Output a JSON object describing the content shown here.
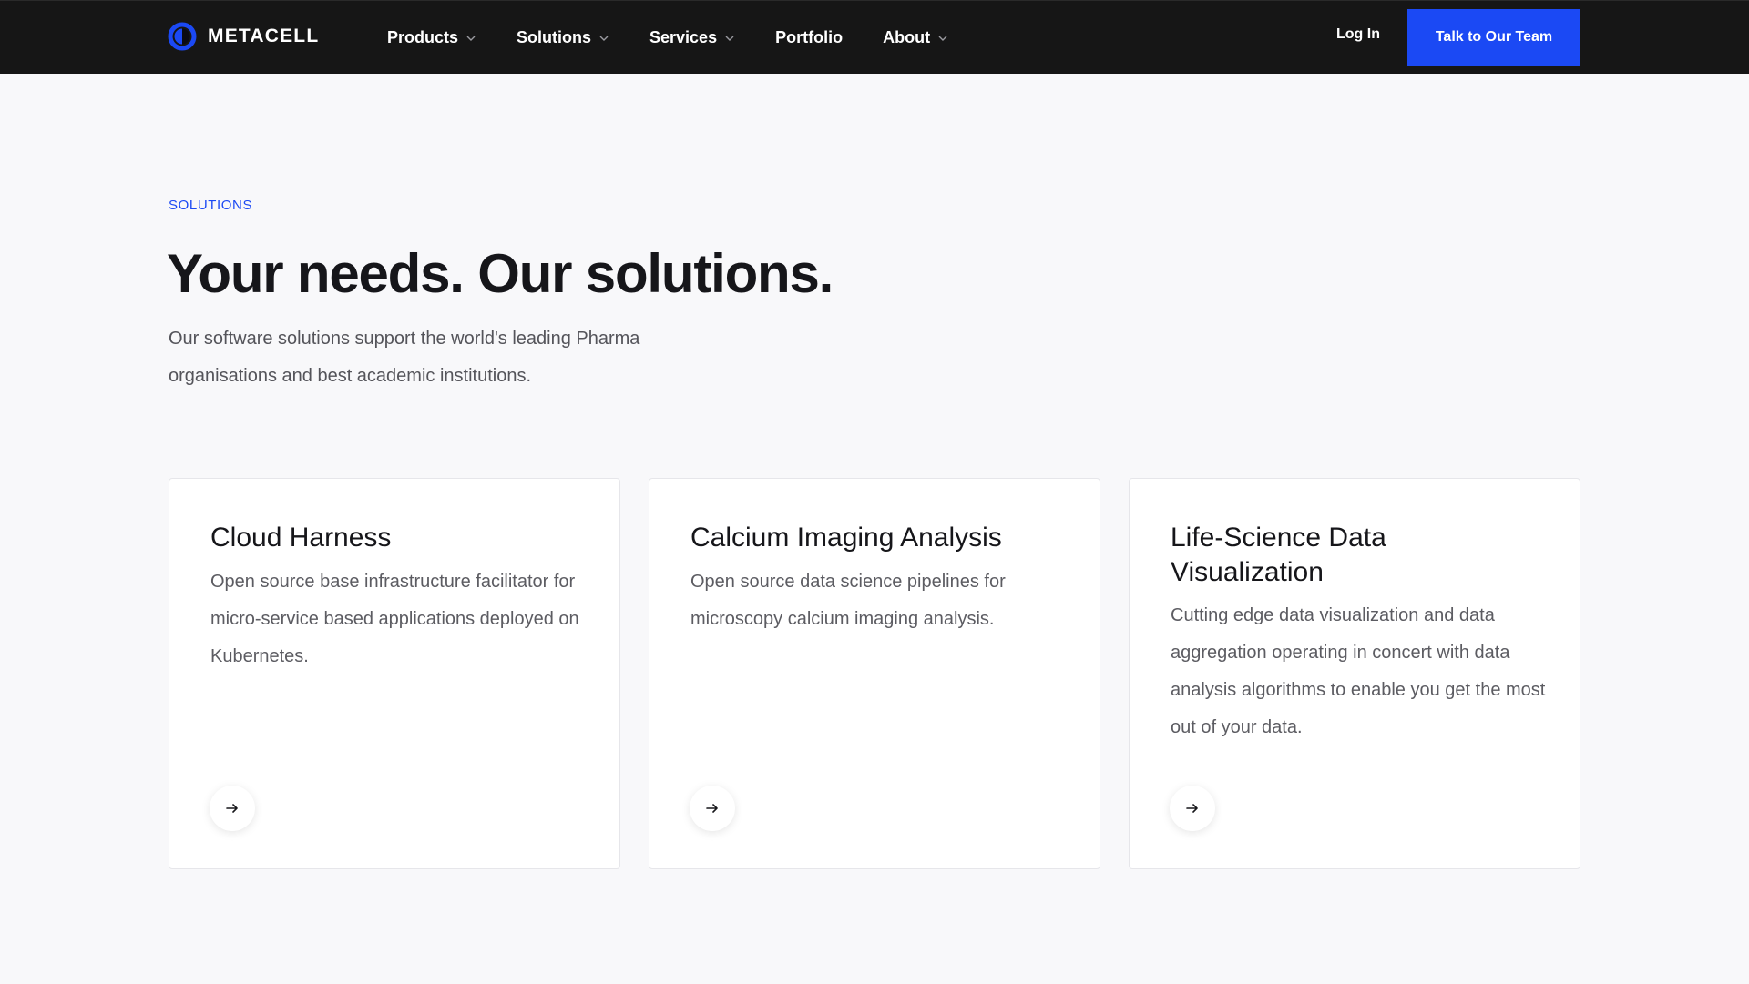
{
  "header": {
    "logo_text": "METACELL",
    "nav": [
      {
        "label": "Products",
        "dropdown": true
      },
      {
        "label": "Solutions",
        "dropdown": true
      },
      {
        "label": "Services",
        "dropdown": true
      },
      {
        "label": "Portfolio",
        "dropdown": false
      },
      {
        "label": "About",
        "dropdown": true
      }
    ],
    "login_label": "Log In",
    "cta_label": "Talk to Our Team"
  },
  "hero": {
    "eyebrow": "SOLUTIONS",
    "headline": "Your needs. Our solutions.",
    "intro": "Our software solutions support the world's leading Pharma organisations and best academic institutions."
  },
  "cards": [
    {
      "title": "Cloud Harness",
      "description": "Open source base infrastructure facilitator for micro-service based applications deployed on Kubernetes.",
      "icon": "arrow-right-icon"
    },
    {
      "title": "Calcium Imaging Analysis",
      "description": "Open source data science pipelines for microscopy calcium imaging analysis.",
      "icon": "arrow-right-icon"
    },
    {
      "title": "Life-Science Data Visualization",
      "description": "Cutting edge data visualization and data aggregation operating in concert with data analysis algorithms to enable you get the most out of your data.",
      "icon": "arrow-right-icon"
    }
  ],
  "colors": {
    "header_bg": "#161616",
    "accent": "#1b49f4",
    "page_bg": "#f8f8fa",
    "card_bg": "#ffffff",
    "text_primary": "#16161a",
    "text_muted": "#5c5c62"
  }
}
